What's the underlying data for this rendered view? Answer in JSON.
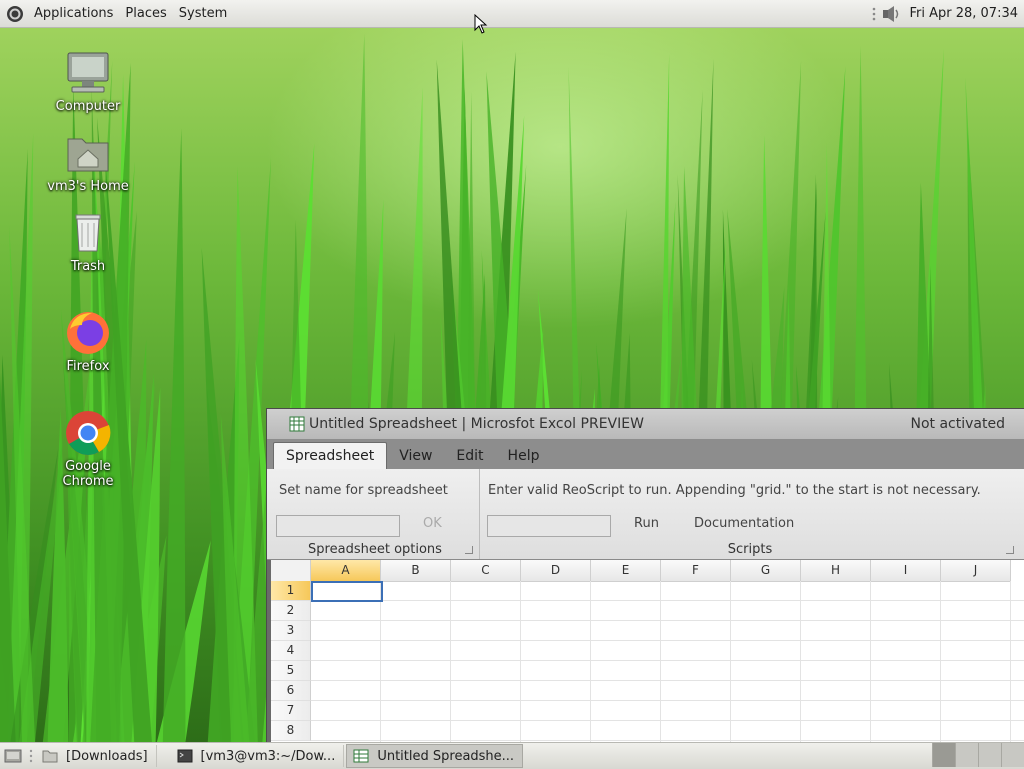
{
  "top_panel": {
    "menus": [
      "Applications",
      "Places",
      "System"
    ],
    "clock": "Fri Apr 28, 07:34"
  },
  "desktop_icons": [
    {
      "label": "Computer",
      "icon": "computer-icon"
    },
    {
      "label": "vm3's Home",
      "icon": "home-folder-icon"
    },
    {
      "label": "Trash",
      "icon": "trash-icon"
    },
    {
      "label": "Firefox",
      "icon": "firefox-icon"
    },
    {
      "label": "Google Chrome",
      "icon": "chrome-icon"
    }
  ],
  "window": {
    "title": "Untitled Spreadsheet | Microsfot Excol PREVIEW",
    "activation": "Not activated",
    "tabs": [
      "Spreadsheet",
      "View",
      "Edit",
      "Help"
    ],
    "active_tab": "Spreadsheet",
    "ribbon": {
      "name_label": "Set name for spreadsheet",
      "name_value": "",
      "ok_label": "OK",
      "group1_label": "Spreadsheet options",
      "script_label": "Enter valid ReoScript to run. Appending \"grid.\" to the start is not necessary.",
      "script_value": "",
      "run_label": "Run",
      "doc_label": "Documentation",
      "group2_label": "Scripts"
    },
    "grid": {
      "columns": [
        "A",
        "B",
        "C",
        "D",
        "E",
        "F",
        "G",
        "H",
        "I",
        "J"
      ],
      "rows": [
        "1",
        "2",
        "3",
        "4",
        "5",
        "6",
        "7",
        "8"
      ],
      "selected_cell": "A1"
    }
  },
  "taskbar": {
    "tasks": [
      {
        "label": "[Downloads]",
        "icon": "folder-icon"
      },
      {
        "label": "[vm3@vm3:~/Dow...",
        "icon": "terminal-icon"
      },
      {
        "label": "Untitled Spreadshe...",
        "icon": "spreadsheet-icon",
        "active": true
      }
    ]
  },
  "colors": {
    "selection_header": "#f6c85a",
    "active_cell_border": "#3b6fb6"
  }
}
